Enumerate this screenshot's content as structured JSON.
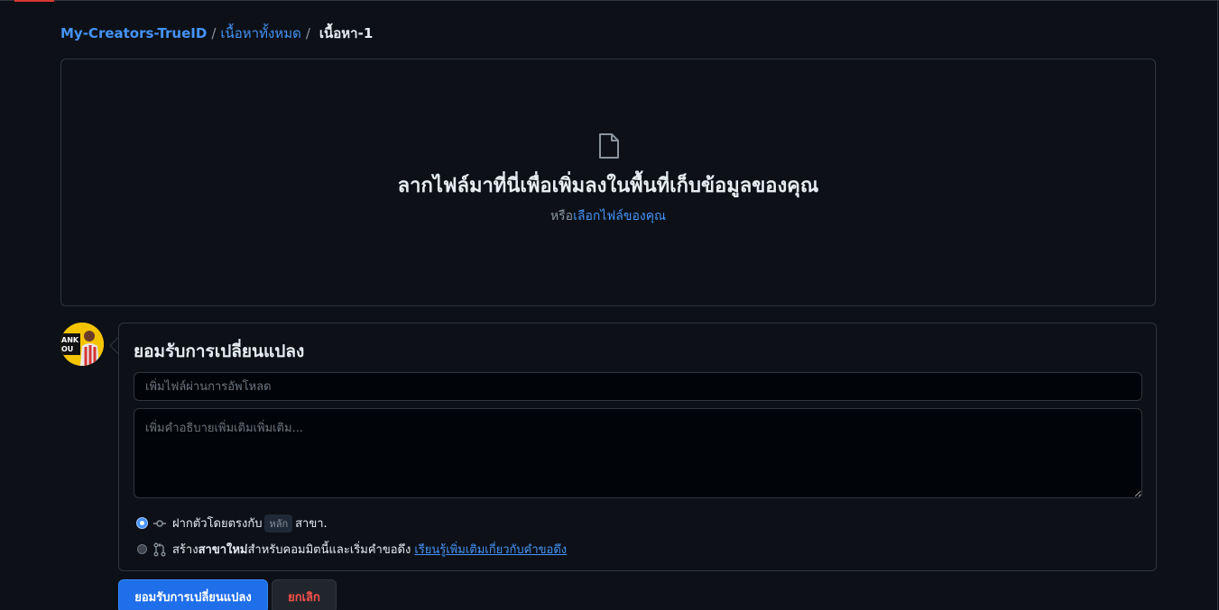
{
  "breadcrumb": {
    "repo": "My-Creators-TrueID",
    "separator": "/",
    "folder": "เนื้อหาทั้งหมด",
    "current": "เนื้อหา-1"
  },
  "dropzone": {
    "icon": "file-icon",
    "title": "ลากไฟล์มาที่นี่เพื่อเพิ่มลงในพื้นที่เก็บข้อมูลของคุณ",
    "or_text": "หรือ",
    "choose_link": "เลือกไฟล์ของคุณ"
  },
  "commit": {
    "avatar_icon": "avatar",
    "title": "ยอมรับการเปลี่ยนแปลง",
    "summary_placeholder": "เพิ่มไฟล์ผ่านการอัพโหลด",
    "description_placeholder": "เพิ่มคำอธิบายเพิ่มเติมเพิ่มเติม...",
    "option_direct": {
      "checked": true,
      "icon": "git-commit-icon",
      "prefix": "ฝากตัวโดยตรงกับ",
      "branch": "หลัก",
      "suffix": "สาขา."
    },
    "option_new_branch": {
      "checked": false,
      "icon": "git-pull-request-icon",
      "prefix": "สร้าง",
      "bold_text": "สาขาใหม่",
      "suffix": "สำหรับคอมมิตนี้และเริ่มคำขอดึง",
      "link": "เรียนรู้เพิ่มเติมเกี่ยวกับคำขอดึง"
    }
  },
  "actions": {
    "commit_button": "ยอมรับการเปลี่ยนแปลง",
    "cancel_button": "ยกเลิก"
  },
  "colors": {
    "background": "#0d1117",
    "border": "#30363d",
    "link": "#4493f8",
    "primary_button": "#1f6feb",
    "danger_text": "#f85149"
  }
}
